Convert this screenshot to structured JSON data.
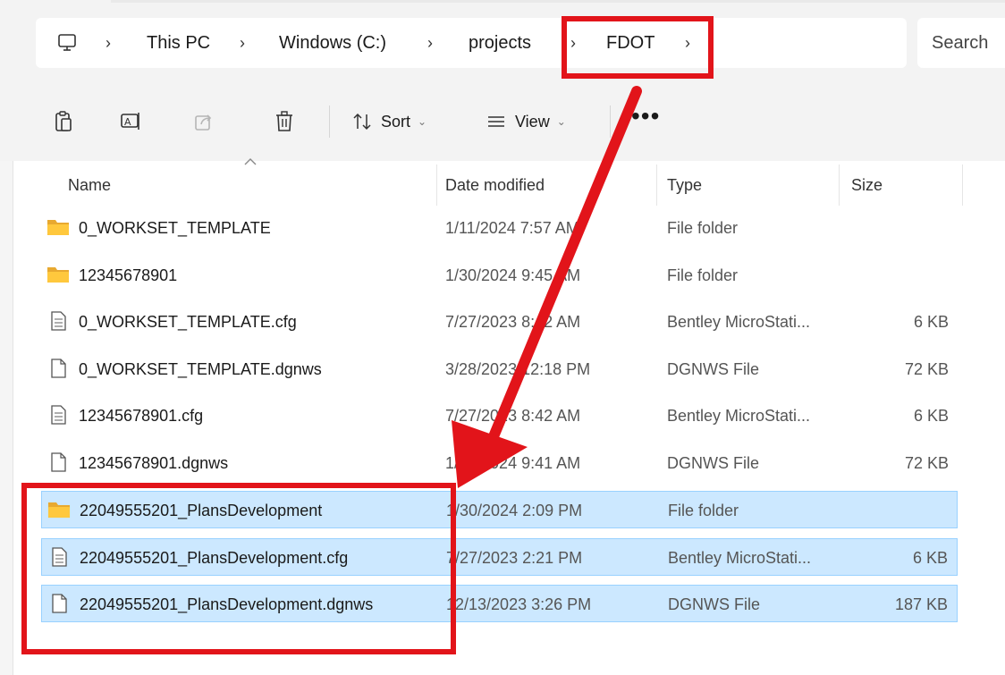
{
  "address_bar": {
    "breadcrumbs": [
      "This PC",
      "Windows (C:)",
      "projects",
      "FDOT"
    ]
  },
  "search": {
    "placeholder": "Search"
  },
  "toolbar": {
    "sort_label": "Sort",
    "view_label": "View"
  },
  "columns": {
    "name": "Name",
    "date_modified": "Date modified",
    "type": "Type",
    "size": "Size"
  },
  "files": [
    {
      "name": "0_WORKSET_TEMPLATE",
      "date": "1/11/2024 7:57 AM",
      "type": "File folder",
      "size": "",
      "icon": "folder-icon",
      "selected": false
    },
    {
      "name": "12345678901",
      "date": "1/30/2024 9:45 AM",
      "type": "File folder",
      "size": "",
      "icon": "folder-icon",
      "selected": false
    },
    {
      "name": "0_WORKSET_TEMPLATE.cfg",
      "date": "7/27/2023 8:42 AM",
      "type": "Bentley MicroStati...",
      "size": "6 KB",
      "icon": "text-file-icon",
      "selected": false
    },
    {
      "name": "0_WORKSET_TEMPLATE.dgnws",
      "date": "3/28/2023 12:18 PM",
      "type": "DGNWS File",
      "size": "72 KB",
      "icon": "blank-file-icon",
      "selected": false
    },
    {
      "name": "12345678901.cfg",
      "date": "7/27/2023 8:42 AM",
      "type": "Bentley MicroStati...",
      "size": "6 KB",
      "icon": "text-file-icon",
      "selected": false
    },
    {
      "name": "12345678901.dgnws",
      "date": "1/30/2024 9:41 AM",
      "type": "DGNWS File",
      "size": "72 KB",
      "icon": "blank-file-icon",
      "selected": false
    },
    {
      "name": "22049555201_PlansDevelopment",
      "date": "1/30/2024 2:09 PM",
      "type": "File folder",
      "size": "",
      "icon": "folder-icon",
      "selected": true
    },
    {
      "name": "22049555201_PlansDevelopment.cfg",
      "date": "7/27/2023 2:21 PM",
      "type": "Bentley MicroStati...",
      "size": "6 KB",
      "icon": "text-file-icon",
      "selected": true
    },
    {
      "name": "22049555201_PlansDevelopment.dgnws",
      "date": "12/13/2023 3:26 PM",
      "type": "DGNWS File",
      "size": "187 KB",
      "icon": "blank-file-icon",
      "selected": true
    }
  ],
  "colors": {
    "annotation_red": "#e2141a",
    "selection_bg": "#cce8ff",
    "folder_yellow": "#ffc83d"
  }
}
